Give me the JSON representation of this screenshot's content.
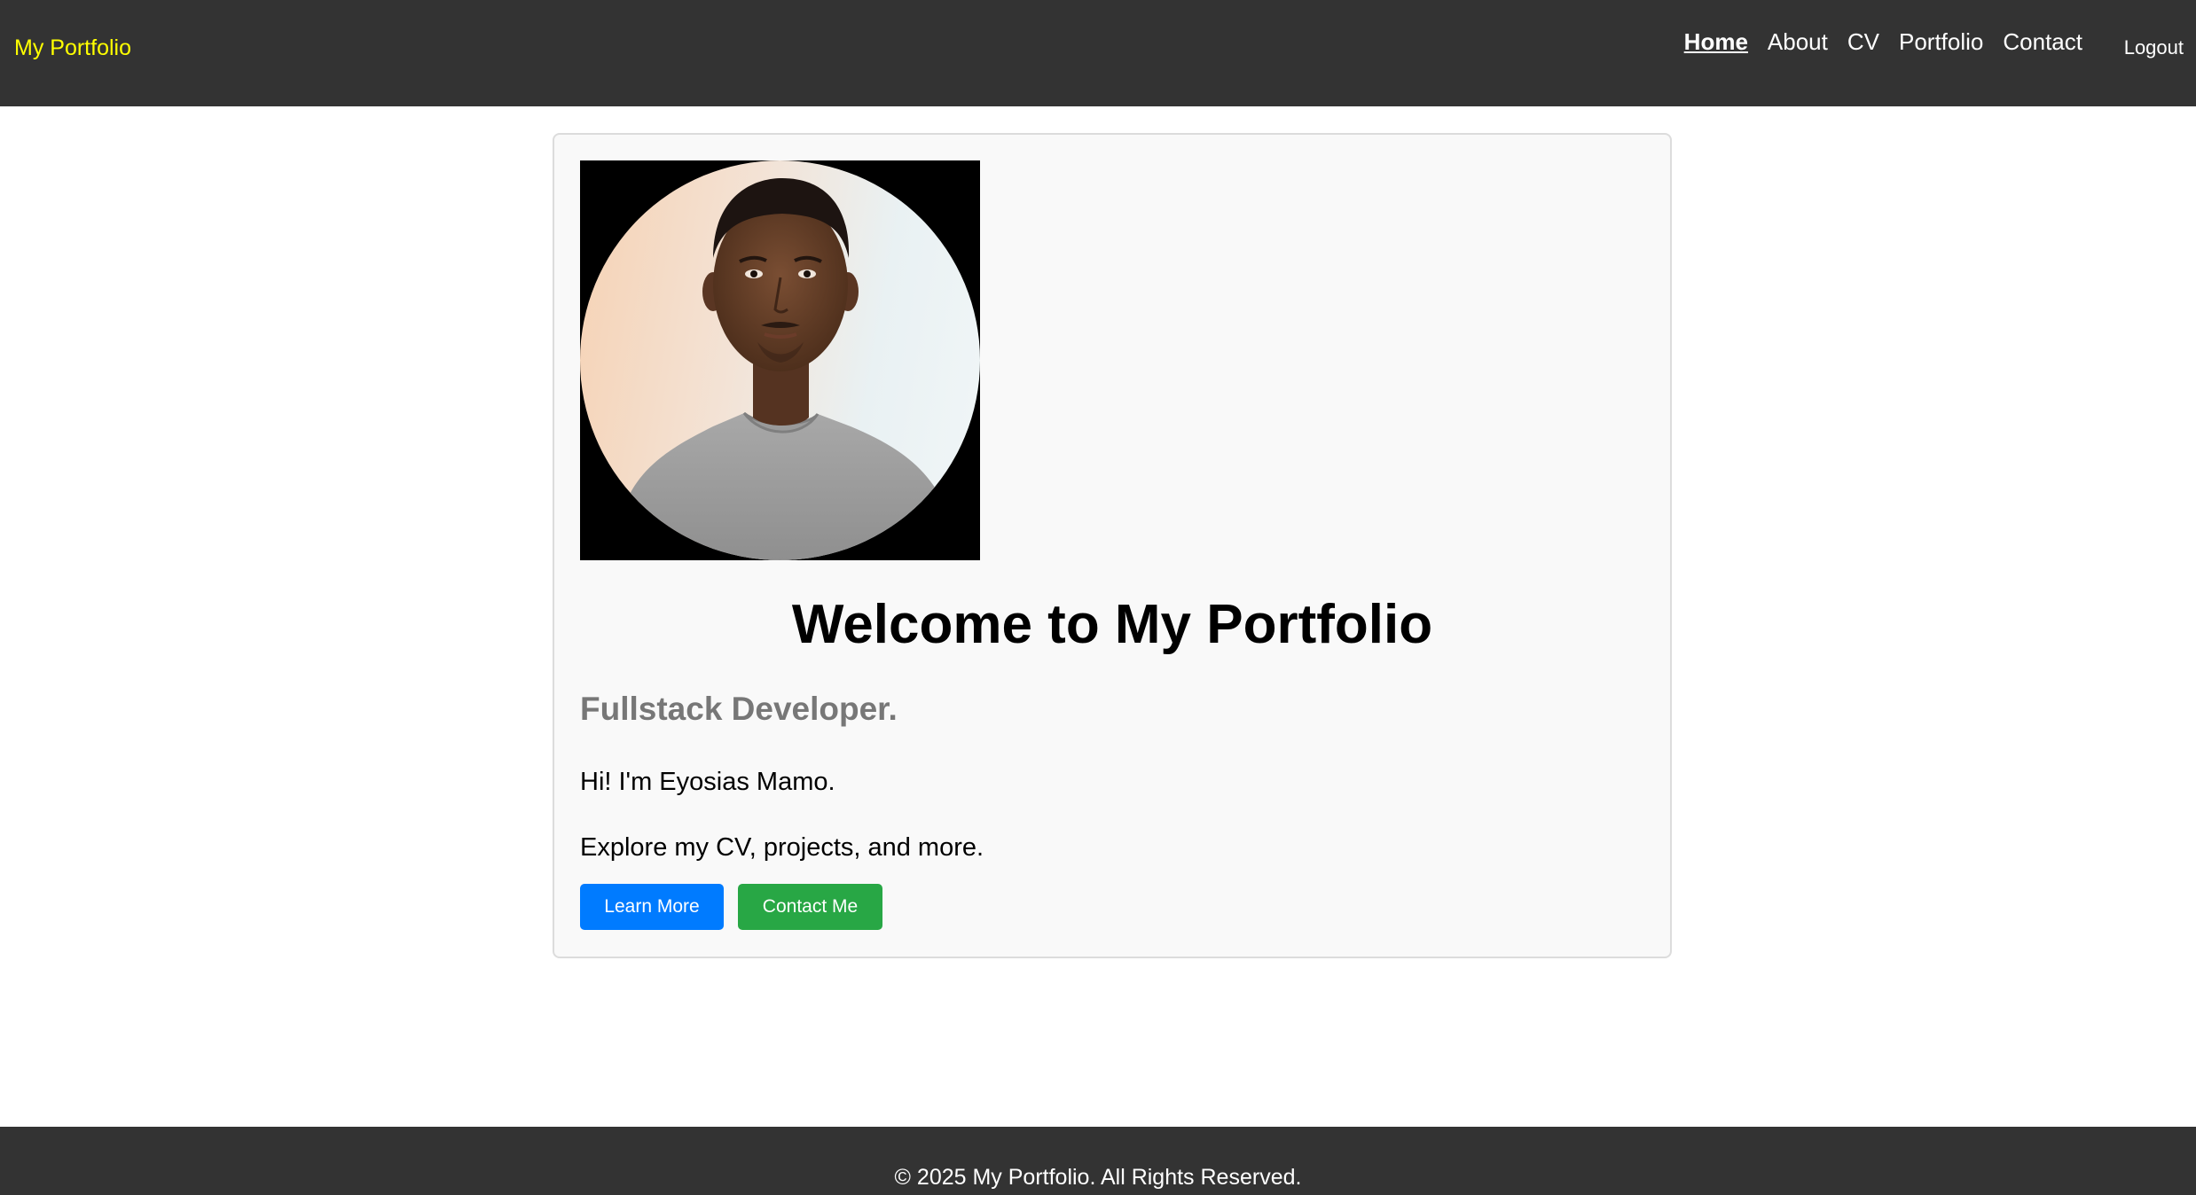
{
  "navbar": {
    "brand": "My Portfolio",
    "links": [
      {
        "label": "Home",
        "active": true
      },
      {
        "label": "About"
      },
      {
        "label": "CV"
      },
      {
        "label": "Portfolio"
      },
      {
        "label": "Contact"
      }
    ],
    "logout_label": "Logout"
  },
  "hero": {
    "title": "Welcome to My Portfolio",
    "role": "Fullstack Developer.",
    "intro": "Hi! I'm Eyosias Mamo.",
    "explore": "Explore my CV, projects, and more.",
    "learn_more_label": "Learn More",
    "contact_me_label": "Contact Me"
  },
  "footer": {
    "text": "© 2025 My Portfolio. All Rights Reserved."
  },
  "colors": {
    "navbar_bg": "#333333",
    "brand": "#ffff00",
    "primary_button": "#007bff",
    "success_button": "#28a745"
  }
}
